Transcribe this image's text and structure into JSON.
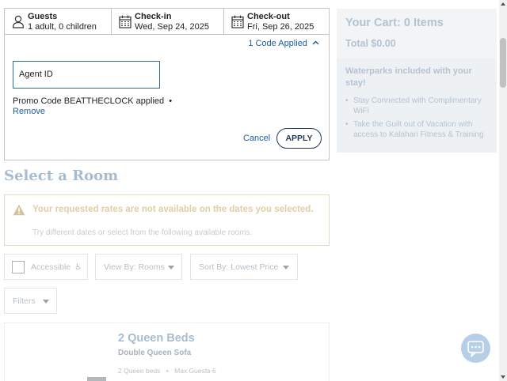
{
  "booking": {
    "guests": {
      "label": "Guests",
      "value": "1 adult, 0 children"
    },
    "checkin": {
      "label": "Check-in",
      "value": "Wed, Sep 24, 2025"
    },
    "checkout": {
      "label": "Check-out",
      "value": "Fri, Sep 26, 2025"
    },
    "codes_toggle": "1 Code Applied",
    "agent_id_placeholder": "Agent ID",
    "promo_text": "Promo Code BEATTHECLOCK applied",
    "promo_separator": "•",
    "remove_label": "Remove",
    "cancel_label": "Cancel",
    "apply_label": "APPLY"
  },
  "cart": {
    "title": "Your Cart: 0 Items",
    "total": "Total $0.00",
    "waterparks_title": "Waterparks included with your stay!",
    "perks": [
      "Stay Connected with Complimentary WiFi",
      "Take the Guilt out of Vacation with access to Kalahari Fitness & Training"
    ]
  },
  "rooms": {
    "section_title": "Select a Room",
    "alert_title": "Your requested rates are not available on the dates you selected.",
    "alert_sub": "Try different dates or select from the following available rooms.",
    "filters": {
      "accessible_label": "Accessible",
      "accessible_glyph": "♿",
      "view_by": "View By: Rooms",
      "sort_by": "Sort By: Lowest Price",
      "filters_label": "Filters"
    },
    "card": {
      "title": "2 Queen Beds",
      "subtitle": "Double Queen Sofa",
      "beds": "2 Queen beds",
      "meta_separator": "•",
      "max_guests": "Max Guests 6"
    }
  },
  "icons": {
    "guests": "person-icon",
    "calendar": "calendar-icon",
    "warning": "warning-icon",
    "chat": "chat-icon",
    "accessible": "wheelchair-icon"
  },
  "colors": {
    "link": "#1b5e9e",
    "apply_border": "#1f3a55",
    "muted_heading": "#a8bccd",
    "alert_text": "#e0cfa6",
    "chat_bubble": "#b7cfe6"
  }
}
